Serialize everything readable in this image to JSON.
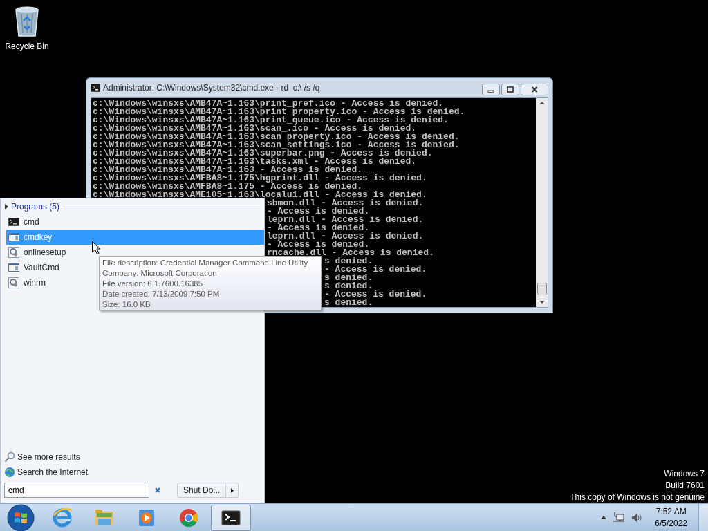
{
  "desktop": {
    "icons": [
      {
        "label": "Recycle Bin"
      }
    ]
  },
  "console_window": {
    "title": "Administrator: C:\\Windows\\System32\\cmd.exe - rd  c:\\ /s /q",
    "lines": [
      {
        "kind": "full",
        "text": "c:\\Windows\\winsxs\\AMB47A~1.163\\print_pref.ico - Access is denied."
      },
      {
        "kind": "full",
        "text": "c:\\Windows\\winsxs\\AMB47A~1.163\\print_property.ico - Access is denied."
      },
      {
        "kind": "full",
        "text": "c:\\Windows\\winsxs\\AMB47A~1.163\\print_queue.ico - Access is denied."
      },
      {
        "kind": "full",
        "text": "c:\\Windows\\winsxs\\AMB47A~1.163\\scan_.ico - Access is denied."
      },
      {
        "kind": "full",
        "text": "c:\\Windows\\winsxs\\AMB47A~1.163\\scan_property.ico - Access is denied."
      },
      {
        "kind": "full",
        "text": "c:\\Windows\\winsxs\\AMB47A~1.163\\scan_settings.ico - Access is denied."
      },
      {
        "kind": "full",
        "text": "c:\\Windows\\winsxs\\AMB47A~1.163\\superbar.png - Access is denied."
      },
      {
        "kind": "full",
        "text": "c:\\Windows\\winsxs\\AMB47A~1.163\\tasks.xml - Access is denied."
      },
      {
        "kind": "full",
        "text": "c:\\Windows\\winsxs\\AMB47A~1.163 - Access is denied."
      },
      {
        "kind": "full",
        "text": "c:\\Windows\\winsxs\\AMFBA8~1.175\\hgprint.dll - Access is denied."
      },
      {
        "kind": "full",
        "text": "c:\\Windows\\winsxs\\AMFBA8~1.175 - Access is denied."
      },
      {
        "kind": "full",
        "text": "c:\\Windows\\winsxs\\AME105~1.163\\localui.dll - Access is denied."
      },
      {
        "kind": "menu_cut",
        "text": "sbmon.dll - Access is denied."
      },
      {
        "kind": "menu_cut",
        "text": "- Access is denied."
      },
      {
        "kind": "menu_cut",
        "text": "leprn.dll - Access is denied."
      },
      {
        "kind": "menu_cut",
        "text": "- Access is denied."
      },
      {
        "kind": "menu_cut",
        "text": "leprn.dll - Access is denied."
      },
      {
        "kind": "menu_cut",
        "text": "- Access is denied."
      },
      {
        "kind": "menu_cut",
        "text": "rncache.dll - Access is denied."
      },
      {
        "kind": "tip_cut",
        "text": "s denied."
      },
      {
        "kind": "tip_cut",
        "text": "- Access is denied."
      },
      {
        "kind": "tip_cut",
        "text": "s denied."
      },
      {
        "kind": "tip_cut",
        "text": "s denied."
      },
      {
        "kind": "tip_cut",
        "text": "- Access is denied."
      },
      {
        "kind": "tip_cut",
        "text": "s denied."
      }
    ]
  },
  "start_menu": {
    "group": {
      "label": "Programs (5)"
    },
    "items": [
      {
        "label": "cmd",
        "kind": "console",
        "selected": false
      },
      {
        "label": "cmdkey",
        "kind": "window",
        "selected": true
      },
      {
        "label": "onlinesetup",
        "kind": "gear",
        "selected": false
      },
      {
        "label": "VaultCmd",
        "kind": "window",
        "selected": false
      },
      {
        "label": "winrm",
        "kind": "gear",
        "selected": false
      }
    ],
    "links": [
      {
        "kind": "search",
        "label": "See more results"
      },
      {
        "kind": "globe",
        "label": "Search the Internet"
      }
    ],
    "search": {
      "value": "cmd"
    },
    "shutdown": {
      "label": "Shut Do..."
    }
  },
  "tooltip": {
    "lines": [
      "File description: Credential Manager Command Line Utility",
      "Company: Microsoft Corporation",
      "File version: 6.1.7600.16385",
      "Date created: 7/13/2009 7:50 PM",
      "Size: 16.0 KB"
    ]
  },
  "notice": [
    "Windows 7",
    "Build 7601",
    "This copy of Windows is not genuine"
  ],
  "taskbar": {
    "apps": [
      {
        "kind": "ie",
        "active": false
      },
      {
        "kind": "folder",
        "active": false
      },
      {
        "kind": "player",
        "active": false
      },
      {
        "kind": "chrome",
        "active": false
      },
      {
        "kind": "console",
        "active": true
      }
    ],
    "clock": {
      "time": "7:52 AM",
      "date": "6/5/2022"
    }
  }
}
